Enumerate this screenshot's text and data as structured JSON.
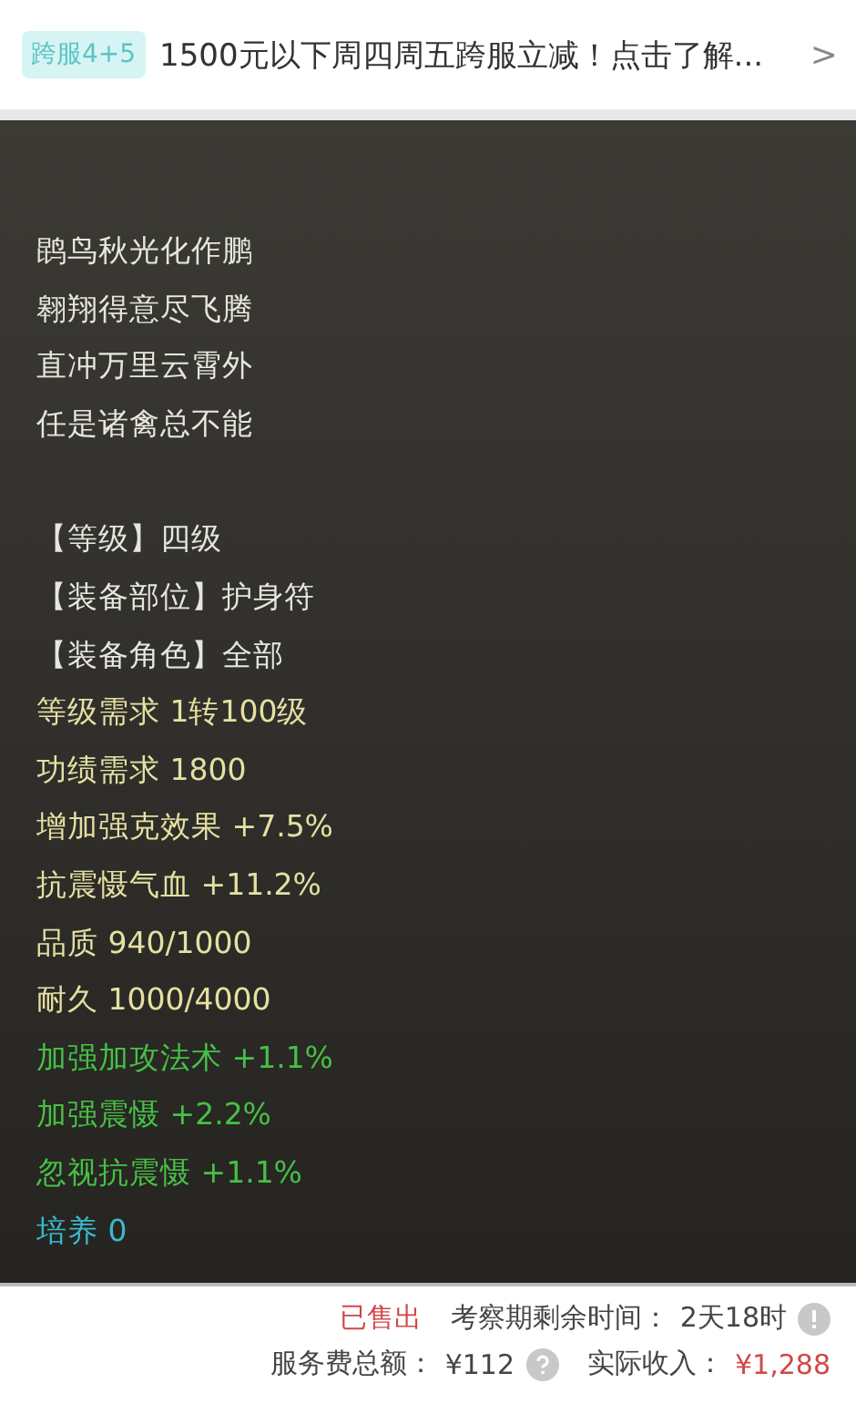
{
  "banner": {
    "tag": "跨服4+5",
    "text": "1500元以下周四周五跨服立减！点击了解...",
    "arrow": ">"
  },
  "item": {
    "poem": [
      "鹍鸟秋光化作鹏",
      "翱翔得意尽飞腾",
      "直冲万里云霄外",
      "任是诸禽总不能"
    ],
    "stats": [
      {
        "kind": "plain",
        "text": "【等级】四级"
      },
      {
        "kind": "plain",
        "text": "【装备部位】护身符"
      },
      {
        "kind": "plain",
        "text": "【装备角色】全部"
      },
      {
        "kind": "requirement",
        "text": "等级需求 1转100级"
      },
      {
        "kind": "requirement",
        "text": "功绩需求 1800"
      },
      {
        "kind": "requirement",
        "text": "增加强克效果 +7.5%"
      },
      {
        "kind": "requirement",
        "text": "抗震慑气血 +11.2%"
      },
      {
        "kind": "requirement",
        "text": "品质 940/1000"
      },
      {
        "kind": "requirement",
        "text": "耐久 1000/4000"
      },
      {
        "kind": "bonus",
        "text": "加强加攻法术 +1.1%"
      },
      {
        "kind": "bonus",
        "text": "加强震慑 +2.2%"
      },
      {
        "kind": "bonus",
        "text": "忽视抗震慑 +1.1%"
      },
      {
        "kind": "growth",
        "text": "培养 0"
      }
    ]
  },
  "footer": {
    "status": "已售出",
    "remaining_label": "考察期剩余时间：",
    "remaining_value": "2天18时",
    "fee_label": "服务费总额：",
    "fee_value": "¥112",
    "income_label": "实际收入：",
    "income_value": "¥1,288"
  }
}
